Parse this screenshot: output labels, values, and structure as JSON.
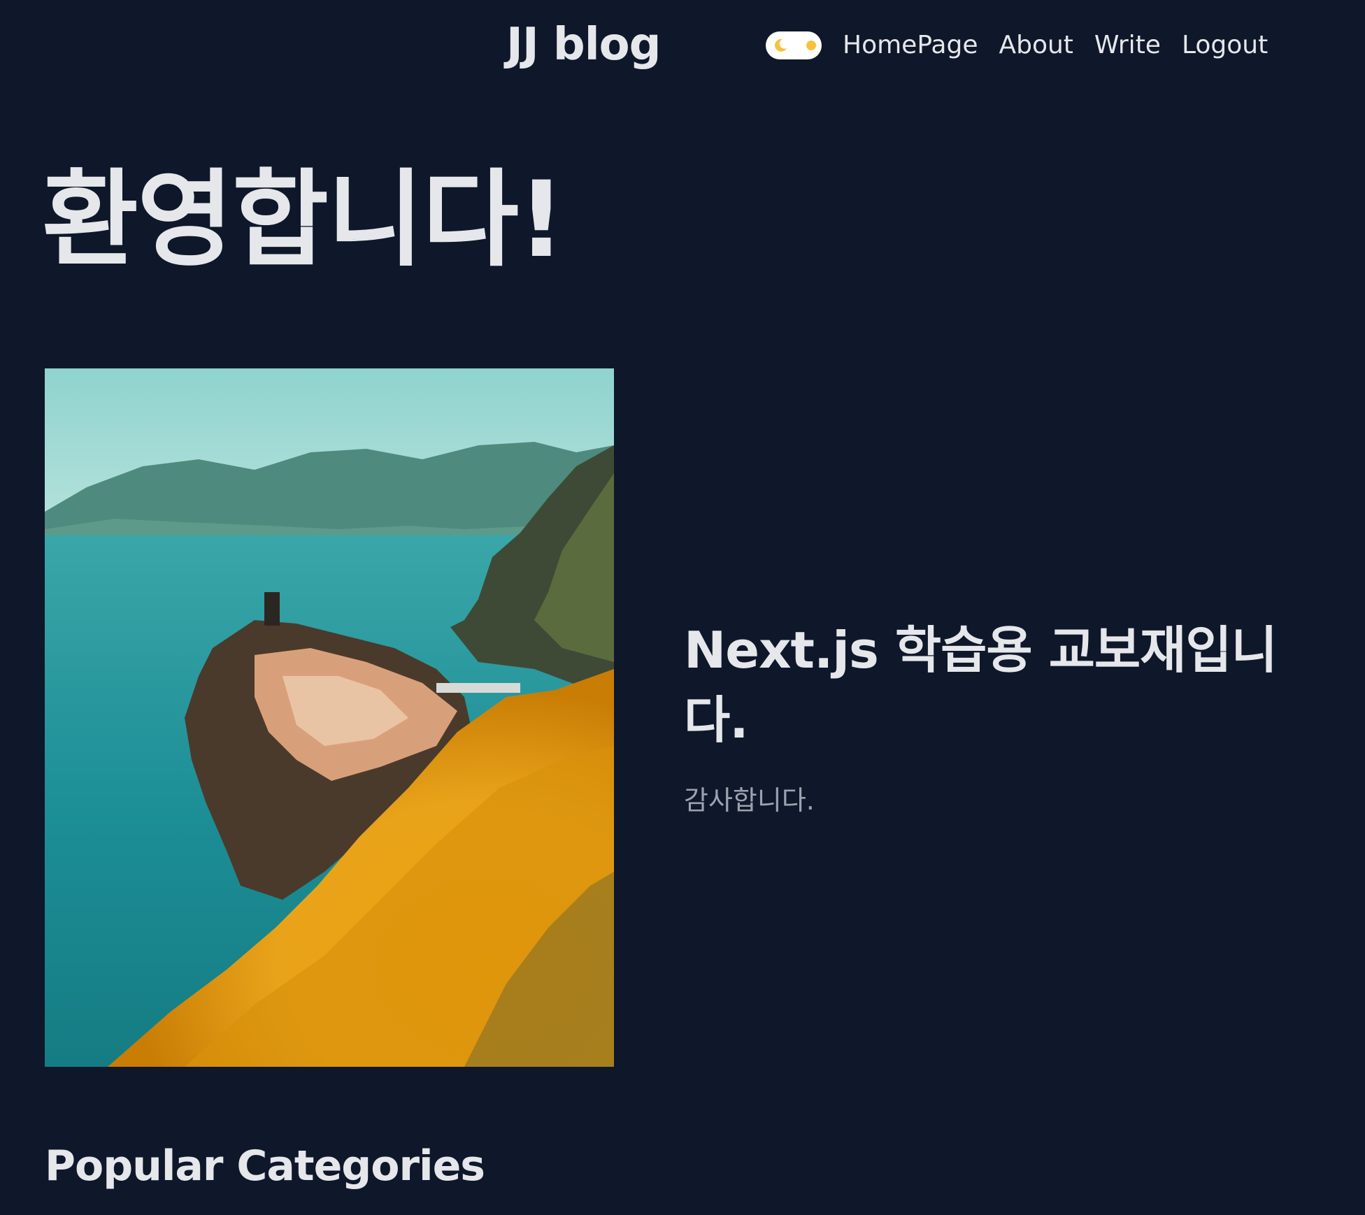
{
  "header": {
    "logo": "JJ blog",
    "theme_toggle": {
      "state": "dark",
      "icons": [
        "moon-icon",
        "sun-icon"
      ]
    },
    "nav": [
      {
        "label": "HomePage"
      },
      {
        "label": "About"
      },
      {
        "label": "Write"
      },
      {
        "label": "Logout"
      }
    ]
  },
  "main": {
    "welcome": "환영합니다!",
    "hero": {
      "title": "Next.js 학습용 교보재입니다.",
      "subtitle": "감사합니다."
    },
    "popular_categories_title": "Popular Categories"
  },
  "colors": {
    "background": "#0f172a",
    "text": "#e5e7eb",
    "muted_text": "#9ca3af",
    "toggle_bg": "#ffffff",
    "toggle_icon": "#f6c23e"
  }
}
